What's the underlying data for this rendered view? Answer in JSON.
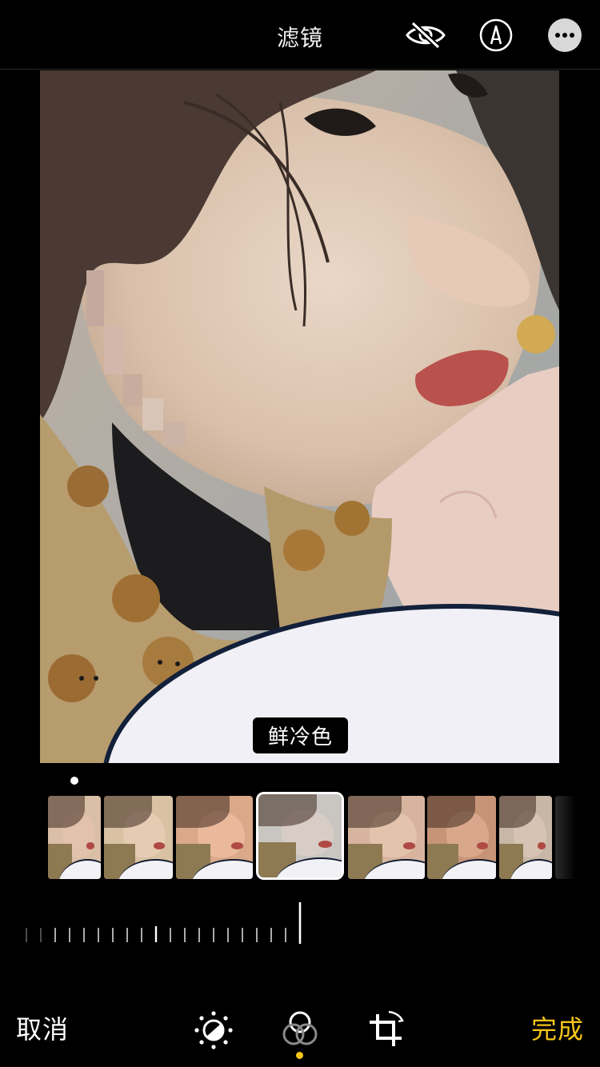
{
  "header": {
    "title": "滤镜",
    "icons": [
      "hide-eye-icon",
      "markup-pen-icon",
      "more-options-icon"
    ]
  },
  "photo": {
    "filter_label": "鲜冷色"
  },
  "filters": {
    "selected_index": 3,
    "thumbnails": [
      {
        "tone": "#d9bfa6",
        "face": "#e2c2ac"
      },
      {
        "tone": "#d8c2a3",
        "face": "#e6cbb3"
      },
      {
        "tone": "#d9a98a",
        "face": "#eab99c"
      },
      {
        "tone": "#c9c6c2",
        "face": "#d8cdc6"
      },
      {
        "tone": "#d6b49e",
        "face": "#e4c3ac"
      },
      {
        "tone": "#c89478",
        "face": "#d9a88c"
      },
      {
        "tone": "#c8b6a6",
        "face": "#d6c3b4"
      }
    ]
  },
  "toolbar": {
    "cancel_label": "取消",
    "done_label": "完成",
    "tools": [
      "adjust-icon",
      "filters-icon",
      "crop-rotate-icon"
    ],
    "active_tool": "filters-icon"
  },
  "colors": {
    "accent": "#f5c518",
    "background": "#000000"
  }
}
